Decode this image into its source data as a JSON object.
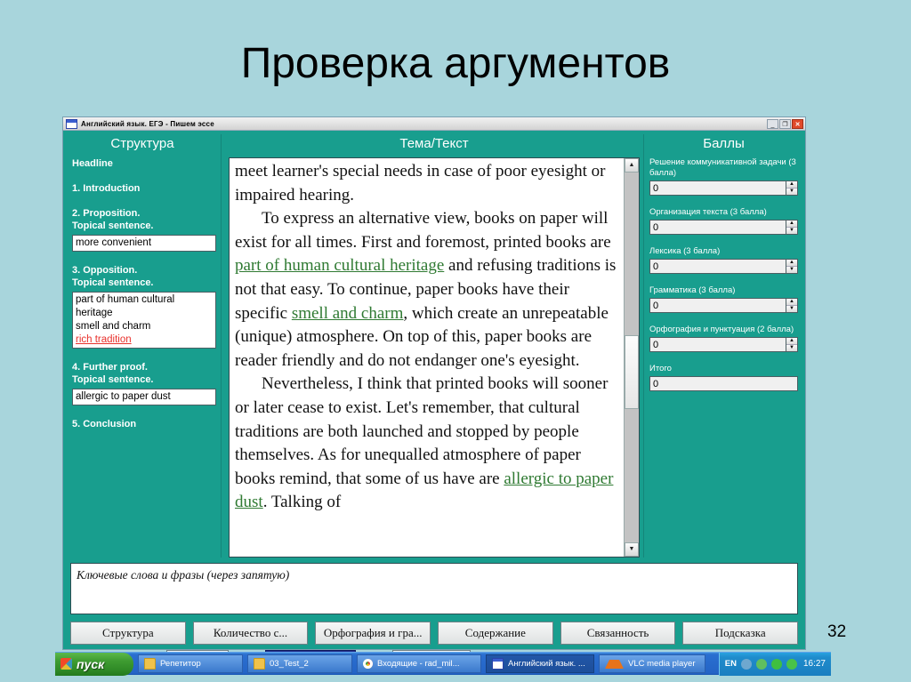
{
  "slide": {
    "title": "Проверка аргументов",
    "page_number": "32",
    "background_color": "#a8d5dc"
  },
  "window": {
    "title": "Английский язык. ЕГЭ - Пишем эссе",
    "app_icon": "window-icon",
    "buttons": {
      "minimize": "_",
      "maximize": "❐",
      "close": "✕"
    },
    "accent_color": "#189e8e"
  },
  "structure": {
    "header": "Структура",
    "items": [
      {
        "label": "Headline"
      },
      {
        "label": "1. Introduction"
      },
      {
        "label": "2. Proposition.\nTopical sentence."
      },
      {
        "label": "3. Opposition.\nTopical sentence."
      },
      {
        "label": "4. Further proof.\nTopical sentence."
      },
      {
        "label": "5. Conclusion"
      }
    ],
    "labels": {
      "headline": "Headline",
      "introduction": "1. Introduction",
      "proposition_l1": "2. Proposition.",
      "proposition_l2": "Topical sentence.",
      "opposition_l1": "3. Opposition.",
      "opposition_l2": "Topical sentence.",
      "further_proof_l1": "4. Further proof.",
      "further_proof_l2": "Topical sentence.",
      "conclusion": "5. Conclusion"
    },
    "proposition_keywords": [
      "more convenient"
    ],
    "opposition_keywords": [
      "part of human cultural",
      "heritage",
      "smell and charm"
    ],
    "opposition_flagged": "rich tradition",
    "further_proof_keywords": [
      "allergic to paper dust"
    ]
  },
  "essay": {
    "header": "Тема/Текст",
    "paragraphs": [
      {
        "indent": false,
        "runs": [
          {
            "text": "meet learner's special needs in case of poor eyesight or impaired hearing.",
            "highlight": false
          }
        ]
      },
      {
        "indent": true,
        "runs": [
          {
            "text": "To express an alternative view, books on paper will exist for all times. First and foremost, printed books are ",
            "highlight": false
          },
          {
            "text": "part of human cultural heritage",
            "highlight": true
          },
          {
            "text": " and refusing traditions is not that easy. To continue, paper books have their specific ",
            "highlight": false
          },
          {
            "text": "smell and charm",
            "highlight": true
          },
          {
            "text": ", which create an unrepeatable (unique) atmosphere. On top of this, paper books are reader friendly and do not endanger one's eyesight.",
            "highlight": false
          }
        ]
      },
      {
        "indent": true,
        "runs": [
          {
            "text": "Nevertheless, I think that printed books will sooner or later cease to exist. Let's remember, that cultural traditions are both launched and stopped by people themselves. As for unequalled atmosphere of paper books remind, that some of us have are ",
            "highlight": false
          },
          {
            "text": "allergic to paper dust",
            "highlight": true
          },
          {
            "text": ". Talking of",
            "highlight": false
          }
        ]
      }
    ],
    "scroll": {
      "up_arrow": "▲",
      "down_arrow": "▼",
      "thumb_position_pct": 44
    },
    "highlight_color": "#2f7a32"
  },
  "scores": {
    "header": "Баллы",
    "fields": [
      {
        "label": "Решение коммуникативной задачи (3 балла)",
        "value": "0",
        "has_spinner": true
      },
      {
        "label": "Организация текста (3 балла)",
        "value": "0",
        "has_spinner": true
      },
      {
        "label": "Лексика (3 балла)",
        "value": "0",
        "has_spinner": true
      },
      {
        "label": "Грамматика (3 балла)",
        "value": "0",
        "has_spinner": true
      },
      {
        "label": "Орфография и пунктуация (2 балла)",
        "value": "0",
        "has_spinner": true
      },
      {
        "label": "Итого",
        "value": "0",
        "has_spinner": false
      }
    ],
    "spinner_up": "▲",
    "spinner_down": "▼"
  },
  "keywords": {
    "placeholder": "Ключевые слова и фразы (через запятую)",
    "value": ""
  },
  "toolbar": {
    "buttons": [
      "Структура",
      "Количество с...",
      "Орфография и гра...",
      "Содержание",
      "Связанность",
      "Подсказка"
    ]
  },
  "taskbar": {
    "start_label": "пуск",
    "items": [
      {
        "label": "Репетитор",
        "icon": "folder-icon",
        "active": false
      },
      {
        "label": "03_Test_2",
        "icon": "folder-icon",
        "active": false
      },
      {
        "label": "Входящие - rad_mil...",
        "icon": "chrome-icon",
        "active": false
      },
      {
        "label": "Английский язык. ...",
        "icon": "window-icon",
        "active": true
      },
      {
        "label": "VLC media player",
        "icon": "vlc-cone-icon",
        "active": false
      }
    ],
    "language": "EN",
    "clock": "16:27"
  }
}
